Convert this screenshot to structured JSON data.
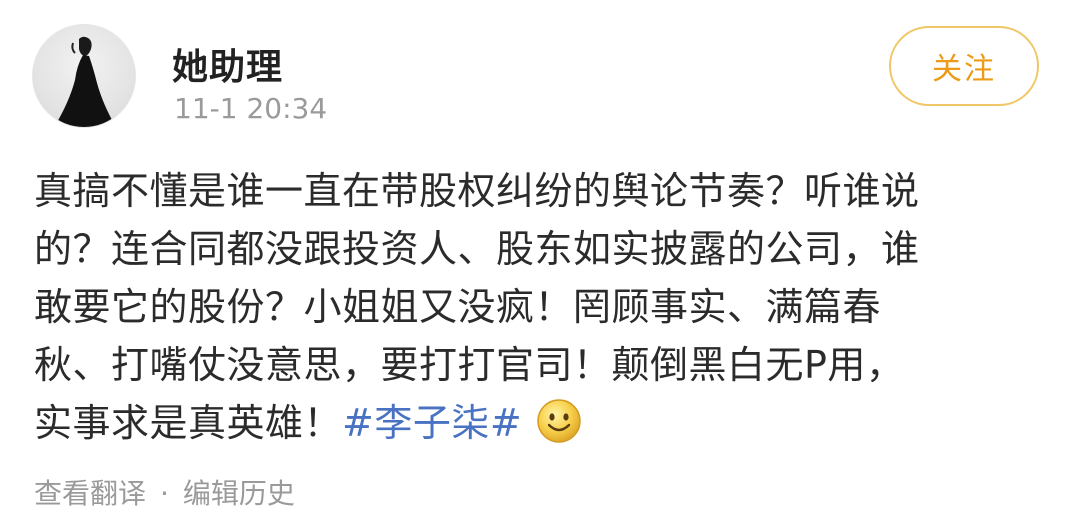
{
  "post": {
    "author": "她助理",
    "timestamp": "11-1 20:34",
    "follow_label": "关注",
    "content_lines": [
      "真搞不懂是谁一直在带股权纠纷的舆论节奏？听谁说",
      "的？连合同都没跟投资人、股东如实披露的公司，谁",
      "敢要它的股份？小姐姐又没疯！罔顾事实、满篇春",
      "秋、打嘴仗没意思，要打打官司！颠倒黑白无P用，"
    ],
    "last_line_text": "实事求是真英雄！",
    "hashtag": "#李子柒#",
    "emoji": "smiley-emoji",
    "footer": {
      "translate_label": "查看翻译",
      "separator": "·",
      "edit_history_label": "编辑历史"
    }
  },
  "colors": {
    "accent": "#ec9b18",
    "hashtag": "#4a72c2",
    "muted": "#9a9a9a"
  }
}
